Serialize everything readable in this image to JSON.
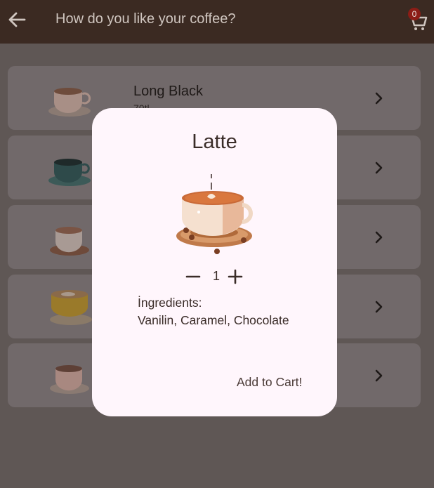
{
  "appbar": {
    "title": "How do you like your coffee?",
    "back_icon": "arrow-left-icon",
    "cart_icon": "shopping-cart-icon",
    "cart_count": "0"
  },
  "list": {
    "items": [
      {
        "name": "Long Black",
        "sub": "70tl"
      },
      {
        "name": "",
        "sub": ""
      },
      {
        "name": "",
        "sub": ""
      },
      {
        "name": "",
        "sub": ""
      },
      {
        "name": "",
        "sub": ""
      }
    ]
  },
  "dialog": {
    "title": "Latte",
    "quantity": "1",
    "ingredients_label": "İngredients:",
    "ingredients": "Vanilin, Caramel, Chocolate",
    "add_button": "Add to Cart!"
  },
  "colors": {
    "appbar": "#3b2a22",
    "scrim": "#5f5755",
    "card": "#71696a",
    "dialog": "#fff6fc",
    "badge": "#8c1d16"
  }
}
